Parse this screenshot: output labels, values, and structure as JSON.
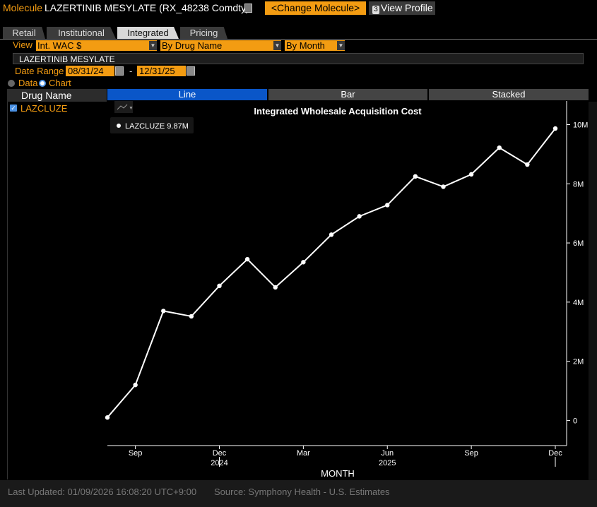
{
  "header": {
    "molecule_label": "Molecule",
    "molecule_name": "LAZERTINIB MESYLATE (RX_48238 Comdty)",
    "change_button": "<Change Molecule>",
    "profile_num": "3",
    "profile_button": "View Profile"
  },
  "tabs": [
    {
      "label": "Retail",
      "active": false
    },
    {
      "label": "Institutional",
      "active": false
    },
    {
      "label": "Integrated",
      "active": true
    },
    {
      "label": "Pricing",
      "active": false
    }
  ],
  "filters": {
    "view_label": "View",
    "view_value": "Int. WAC $",
    "group_value": "By Drug Name",
    "period_value": "By Month",
    "molecule_bar": "LAZERTINIB MESYLATE",
    "date_range_label": "Date Range",
    "date_from": "08/31/24",
    "date_sep": "-",
    "date_to": "12/31/25",
    "mode_data": "Data",
    "mode_chart": "Chart"
  },
  "drug_list": {
    "header": "Drug Name",
    "items": [
      {
        "name": "LAZCLUZE",
        "checked": true
      }
    ]
  },
  "chart_tabs": [
    {
      "label": "Line",
      "active": true
    },
    {
      "label": "Bar",
      "active": false
    },
    {
      "label": "Stacked",
      "active": false
    }
  ],
  "chart_data": {
    "type": "line",
    "title": "Integrated Wholesale Acquisition Cost",
    "xlabel": "MONTH",
    "ylabel": "",
    "x": [
      "2024-08",
      "2024-09",
      "2024-10",
      "2024-11",
      "2024-12",
      "2025-01",
      "2025-02",
      "2025-03",
      "2025-04",
      "2025-05",
      "2025-06",
      "2025-07",
      "2025-08",
      "2025-09",
      "2025-10",
      "2025-11",
      "2025-12"
    ],
    "series": [
      {
        "name": "LAZCLUZE",
        "values": [
          0.1,
          1.2,
          3.7,
          3.52,
          4.55,
          5.45,
          4.5,
          5.35,
          6.28,
          6.9,
          7.28,
          8.25,
          7.9,
          8.32,
          9.22,
          8.65,
          9.87
        ],
        "color": "#ffffff"
      }
    ],
    "legend_text": "LAZCLUZE 9.87M",
    "ylim": [
      -0.85,
      10.8
    ],
    "yticks": [
      0,
      2,
      4,
      6,
      8,
      10
    ],
    "ytick_labels": [
      "0",
      "2M",
      "4M",
      "6M",
      "8M",
      "10M"
    ],
    "xtick_labels": [
      {
        "month": "2024-09",
        "label": "Sep"
      },
      {
        "month": "2024-12",
        "label": "Dec"
      },
      {
        "month": "2025-03",
        "label": "Mar"
      },
      {
        "month": "2025-06",
        "label": "Jun"
      },
      {
        "month": "2025-09",
        "label": "Sep"
      },
      {
        "month": "2025-12",
        "label": "Dec"
      }
    ],
    "year_labels": [
      {
        "month": "2024-12",
        "label": "2024"
      },
      {
        "month": "2025-06",
        "label": "2025"
      }
    ],
    "legend_placement": "top-left",
    "grid": false
  },
  "footer": {
    "last_updated": "Last Updated: 01/09/2026 16:08:20 UTC+9:00",
    "source": "Source: Symphony Health - U.S. Estimates"
  },
  "colors": {
    "accent": "#f39c12",
    "active_tab": "#0a56c8"
  }
}
